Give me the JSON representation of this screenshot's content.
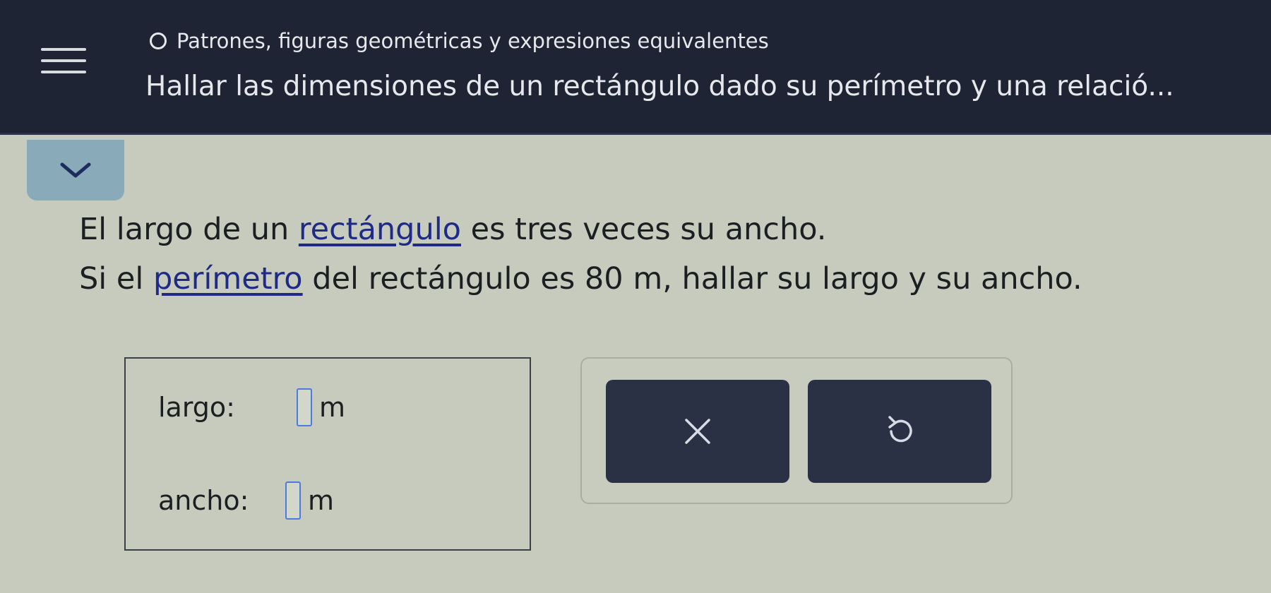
{
  "header": {
    "topic": "Patrones, figuras geométricas y expresiones equivalentes",
    "lesson_title": "Hallar las dimensiones de un rectángulo dado su perímetro y una relació..."
  },
  "question": {
    "line1_pre": "El largo de un ",
    "line1_link": "rectángulo",
    "line1_post": " es tres veces su ancho.",
    "line2_pre": "Si el ",
    "line2_link": "perímetro",
    "line2_post": " del rectángulo es 80 m, hallar su largo y su ancho."
  },
  "answers": [
    {
      "label": "largo:",
      "value": "",
      "unit": "m"
    },
    {
      "label": "ancho:",
      "value": "",
      "unit": "m"
    }
  ],
  "icons": {
    "menu": "menu-icon",
    "topic_status": "circle-icon",
    "collapse": "chevron-down-icon",
    "clear": "close-icon",
    "undo": "undo-icon"
  },
  "colors": {
    "topbar": "#1f2435",
    "background": "#c6cbbd",
    "link": "#1e2a86",
    "input_border": "#4a7be0",
    "action_button": "#2a3145"
  }
}
